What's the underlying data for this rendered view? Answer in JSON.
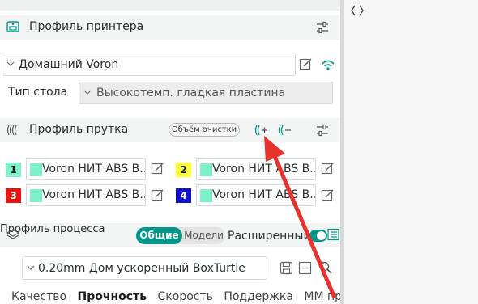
{
  "printer": {
    "title": "Профиль принтера",
    "preset": "Домашний Voron",
    "bed_label": "Тип стола",
    "bed_value": "Высокотемп. гладкая пластина"
  },
  "filament": {
    "title": "Профиль прутка",
    "purge_button": "Объём очистки",
    "slots": [
      {
        "num": "1",
        "color": "#7ff0c8",
        "name": "Voron НИТ ABS В..."
      },
      {
        "num": "2",
        "color": "#ffff33",
        "name": "Voron НИТ ABS В..."
      },
      {
        "num": "3",
        "color": "#ee1111",
        "name": "Voron НИТ ABS В..."
      },
      {
        "num": "4",
        "color": "#1111cc",
        "name": "Voron НИТ ABS В..."
      }
    ]
  },
  "process": {
    "title": "Профиль процесса",
    "toggle_global": "Общие",
    "toggle_objects": "Модели",
    "advanced_label": "Расширенный",
    "preset": "0.20mm Дом ускоренный BoxTurtle"
  },
  "tabs": [
    "Качество",
    "Прочность",
    "Скорость",
    "Поддержка",
    "ММ принт..."
  ],
  "active_tab": "Прочность",
  "colors": {
    "accent": "#009688",
    "annotation_arrow": "#e8322e"
  }
}
